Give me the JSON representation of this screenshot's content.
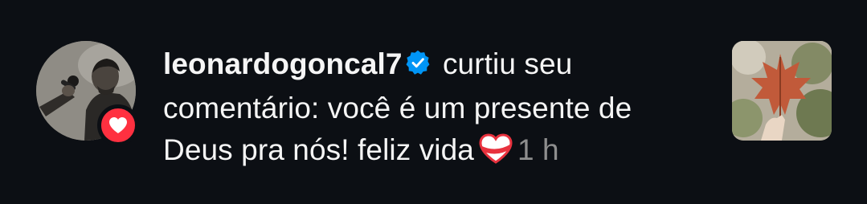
{
  "notification": {
    "username": "leonardogoncal7",
    "action": " curtiu seu",
    "comment": "comentário: você é um presente de Deus pra nós! feliz vida",
    "time": "1 h"
  },
  "colors": {
    "background": "#0c0f14",
    "text": "#f5f5f5",
    "muted": "#8e8e8e",
    "like_red": "#ff3040",
    "verified_blue": "#0095f6"
  },
  "icons": {
    "verified": "verified-badge-icon",
    "like": "heart-icon",
    "emoji": "heart-emoji"
  }
}
